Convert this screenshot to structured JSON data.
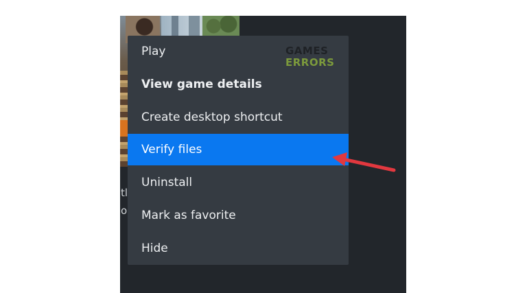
{
  "context_menu": {
    "items": [
      {
        "label": "Play"
      },
      {
        "label": "View game details"
      },
      {
        "label": "Create desktop shortcut"
      },
      {
        "label": "Verify files"
      },
      {
        "label": "Uninstall"
      },
      {
        "label": "Mark as favorite"
      },
      {
        "label": "Hide"
      }
    ],
    "highlighted_item": "Verify files",
    "highlight_color": "#0a78f0",
    "background_color": "#353b42"
  },
  "watermark": {
    "line1": "GAMES",
    "line2": "ERRORS",
    "line2_color": "#7c9a3c"
  },
  "annotation": {
    "arrow_color": "#e2383f",
    "points_to": "Verify files"
  },
  "background_fragments": {
    "line1": "tla",
    "line2": "or"
  },
  "icons": [
    "annotation-arrow-icon",
    "game-cover-art"
  ]
}
